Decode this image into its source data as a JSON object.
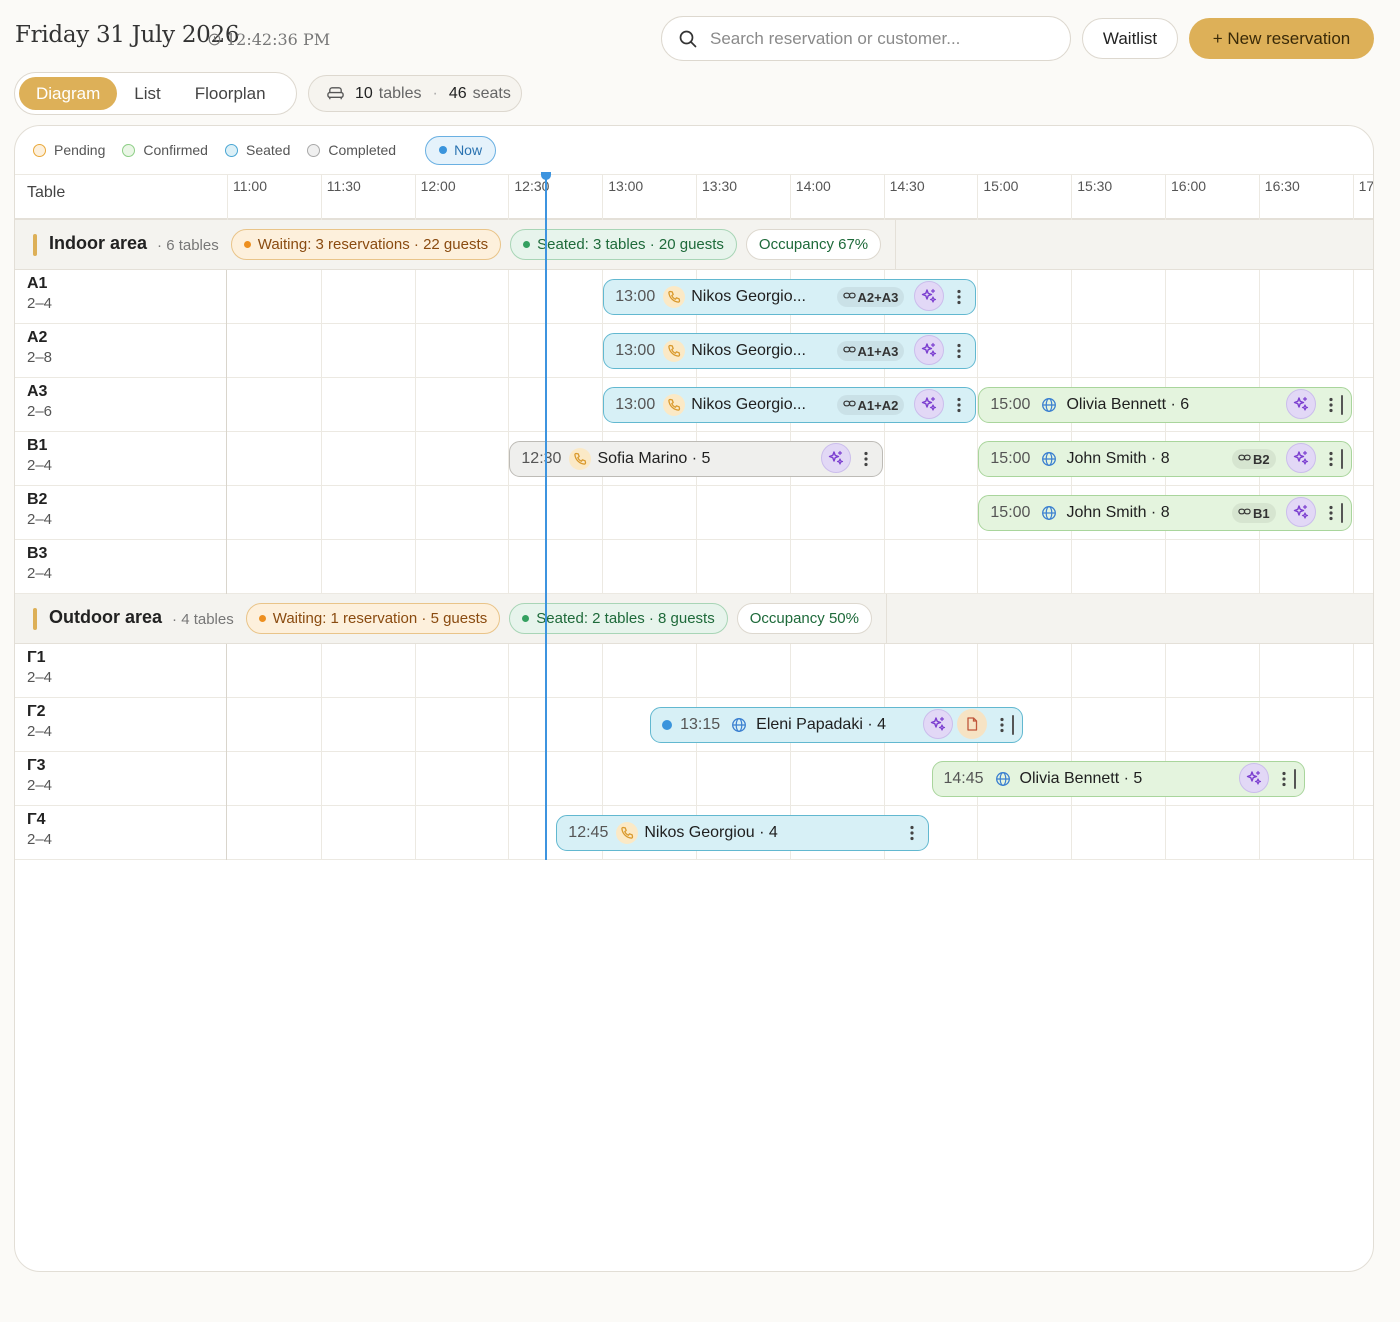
{
  "header": {
    "date": "Friday 31 July 2026",
    "time": "12:42:36 PM",
    "search_placeholder": "Search reservation or customer...",
    "waitlist_label": "Waitlist",
    "new_reservation_label": "+ New reservation"
  },
  "views": {
    "tabs": [
      "Diagram",
      "List",
      "Floorplan"
    ],
    "active": "Diagram"
  },
  "stats": {
    "tables": "10",
    "tables_label": "tables",
    "seats": "46",
    "seats_label": "seats"
  },
  "legend": {
    "items": [
      {
        "label": "Pending",
        "color": "#e9a83a",
        "fill": "#fdf0dc"
      },
      {
        "label": "Confirmed",
        "color": "#8fcf88",
        "fill": "#eaf6e6"
      },
      {
        "label": "Seated",
        "color": "#4aa6d4",
        "fill": "#dcf0f7"
      },
      {
        "label": "Completed",
        "color": "#a9a9a9",
        "fill": "#f0f0f0"
      }
    ],
    "now_label": "Now"
  },
  "timeline": {
    "table_header": "Table",
    "ticks": [
      "11:00",
      "11:30",
      "12:00",
      "12:30",
      "13:00",
      "13:30",
      "14:00",
      "14:30",
      "15:00",
      "15:30",
      "16:00",
      "16:30",
      "17"
    ],
    "now": "12:42"
  },
  "areas": [
    {
      "name": "Indoor area",
      "count": "· 6 tables",
      "waiting": "Waiting: 3 reservations · 22 guests",
      "seated": "Seated: 3 tables · 20 guests",
      "occupancy": "Occupancy 67%",
      "tables": [
        {
          "name": "A1",
          "capacity": "2–4"
        },
        {
          "name": "A2",
          "capacity": "2–8"
        },
        {
          "name": "A3",
          "capacity": "2–6"
        },
        {
          "name": "B1",
          "capacity": "2–4"
        },
        {
          "name": "B2",
          "capacity": "2–4"
        },
        {
          "name": "B3",
          "capacity": "2–4"
        }
      ]
    },
    {
      "name": "Outdoor area",
      "count": "· 4 tables",
      "waiting": "Waiting: 1 reservation · 5 guests",
      "seated": "Seated: 2 tables · 8 guests",
      "occupancy": "Occupancy 50%",
      "tables": [
        {
          "name": "Γ1",
          "capacity": "2–4"
        },
        {
          "name": "Γ2",
          "capacity": "2–4"
        },
        {
          "name": "Γ3",
          "capacity": "2–4"
        },
        {
          "name": "Γ4",
          "capacity": "2–4"
        }
      ]
    }
  ],
  "reservations": [
    {
      "table": "A1",
      "time": "13:00",
      "name": "Nikos Georgio...",
      "status": "seated",
      "source": "phone-icon",
      "link": "A2+A3",
      "start": "13:00",
      "end": "15:00"
    },
    {
      "table": "A2",
      "time": "13:00",
      "name": "Nikos Georgio...",
      "status": "seated",
      "source": "phone-icon",
      "link": "A1+A3",
      "start": "13:00",
      "end": "15:00"
    },
    {
      "table": "A3",
      "time": "13:00",
      "name": "Nikos Georgio...",
      "status": "seated",
      "source": "phone-icon",
      "link": "A1+A2",
      "start": "13:00",
      "end": "15:00"
    },
    {
      "table": "A3",
      "time": "15:00",
      "name": "Olivia Bennett · 6",
      "status": "confirmed",
      "source": "globe-icon",
      "link": "",
      "start": "15:00",
      "end": "17:00"
    },
    {
      "table": "B1",
      "time": "12:30",
      "name": "Sofia Marino · 5",
      "status": "completed",
      "source": "phone-icon",
      "link": "",
      "start": "12:30",
      "end": "14:30"
    },
    {
      "table": "B1",
      "time": "15:00",
      "name": "John Smith · 8",
      "status": "confirmed",
      "source": "globe-icon",
      "link": "B2",
      "start": "15:00",
      "end": "17:00"
    },
    {
      "table": "B2",
      "time": "15:00",
      "name": "John Smith · 8",
      "status": "confirmed",
      "source": "globe-icon",
      "link": "B1",
      "start": "15:00",
      "end": "17:00"
    },
    {
      "table": "Γ2",
      "time": "13:15",
      "name": "Eleni Papadaki · 4",
      "status": "seated",
      "source": "globe-icon",
      "link": "",
      "note": true,
      "dot": true,
      "start": "13:15",
      "end": "15:15"
    },
    {
      "table": "Γ3",
      "time": "14:45",
      "name": "Olivia Bennett · 5",
      "status": "confirmed",
      "source": "globe-icon",
      "link": "",
      "start": "14:45",
      "end": "16:45"
    },
    {
      "table": "Γ4",
      "time": "12:45",
      "name": "Nikos Georgiou · 4",
      "status": "seated",
      "source": "phone-icon",
      "link": "",
      "nospark": true,
      "start": "12:45",
      "end": "14:45"
    }
  ]
}
